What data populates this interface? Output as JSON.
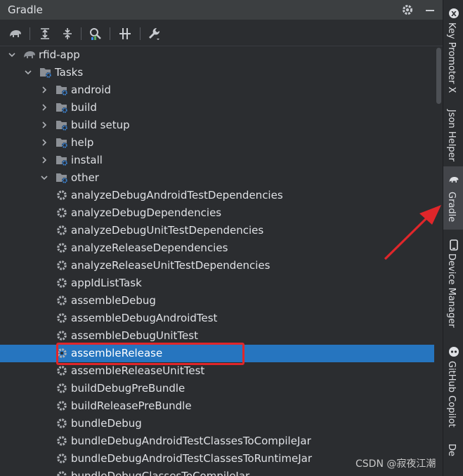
{
  "panel": {
    "title": "Gradle"
  },
  "titlebar_icons": [
    "gear-icon",
    "minimize-icon"
  ],
  "toolbar": {
    "tools": [
      "gradle-elephant-icon",
      "expand-all-icon",
      "collapse-all-icon",
      "analyze-dependencies-icon",
      "toggle-offline-icon",
      "build-settings-icon"
    ]
  },
  "tree": {
    "project": "rfid-app",
    "tasks_label": "Tasks",
    "groups": [
      "android",
      "build",
      "build setup",
      "help",
      "install",
      "other"
    ],
    "other_tasks": [
      "analyzeDebugAndroidTestDependencies",
      "analyzeDebugDependencies",
      "analyzeDebugUnitTestDependencies",
      "analyzeReleaseDependencies",
      "analyzeReleaseUnitTestDependencies",
      "appIdListTask",
      "assembleDebug",
      "assembleDebugAndroidTest",
      "assembleDebugUnitTest",
      "assembleRelease",
      "assembleReleaseUnitTest",
      "buildDebugPreBundle",
      "buildReleasePreBundle",
      "bundleDebug",
      "bundleDebugAndroidTestClassesToCompileJar",
      "bundleDebugAndroidTestClassesToRuntimeJar",
      "bundleDebugClassesToCompileJar"
    ],
    "selected_task": "assembleRelease"
  },
  "side_stripe": [
    {
      "label": "Key Promoter X",
      "icon": "key-promoter-icon"
    },
    {
      "label": "Json Helper",
      "icon": ""
    },
    {
      "label": "Gradle",
      "icon": "gradle-elephant-icon",
      "active": true
    },
    {
      "label": "Device Manager",
      "icon": "device-manager-icon"
    },
    {
      "label": "GitHub Copilot",
      "icon": "copilot-icon"
    },
    {
      "label": "De",
      "icon": ""
    }
  ],
  "watermark": "CSDN @寂夜江潮",
  "colors": {
    "selection": "#2675bf",
    "highlight": "#e0262a",
    "background": "#2b2d30"
  }
}
